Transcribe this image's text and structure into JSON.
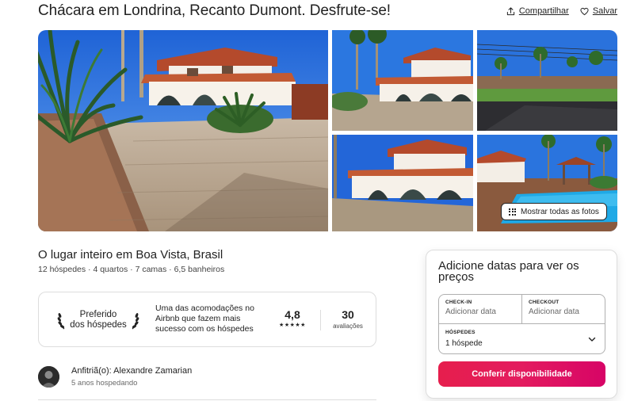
{
  "listing": {
    "title": "Chácara em Londrina, Recanto Dumont. Desfrute-se!",
    "share_label": "Compartilhar",
    "save_label": "Salvar"
  },
  "gallery": {
    "show_all_label": "Mostrar todas as fotos"
  },
  "overview": {
    "title": "O lugar inteiro em Boa Vista, Brasil",
    "details": "12 hóspedes · 4 quartos · 7 camas · 6,5 banheiros"
  },
  "guest_favorite": {
    "badge_line1": "Preferido",
    "badge_line2": "dos hóspedes",
    "description": "Uma das acomodações no Airbnb que fazem mais sucesso com os hóspedes",
    "rating": "4,8",
    "stars": "★★★★★",
    "reviews_count": "30",
    "reviews_label": "avaliações"
  },
  "host": {
    "name": "Anfitriã(o): Alexandre Zamarian",
    "tenure": "5 anos hospedando"
  },
  "booking": {
    "title": "Adicione datas para ver os preços",
    "checkin_label": "CHECK-IN",
    "checkin_placeholder": "Adicionar data",
    "checkout_label": "CHECKOUT",
    "checkout_placeholder": "Adicionar data",
    "guests_label": "HÓSPEDES",
    "guests_value": "1 hóspede",
    "cta_label": "Conferir disponibilidade"
  },
  "colors": {
    "brand_primary": "#e61e4d",
    "brand_end": "#d70466",
    "text": "#222222",
    "border": "#dddddd"
  },
  "icons": [
    "share-icon",
    "heart-icon",
    "grid-icon",
    "laurel-left-icon",
    "laurel-right-icon",
    "chevron-down-icon"
  ]
}
